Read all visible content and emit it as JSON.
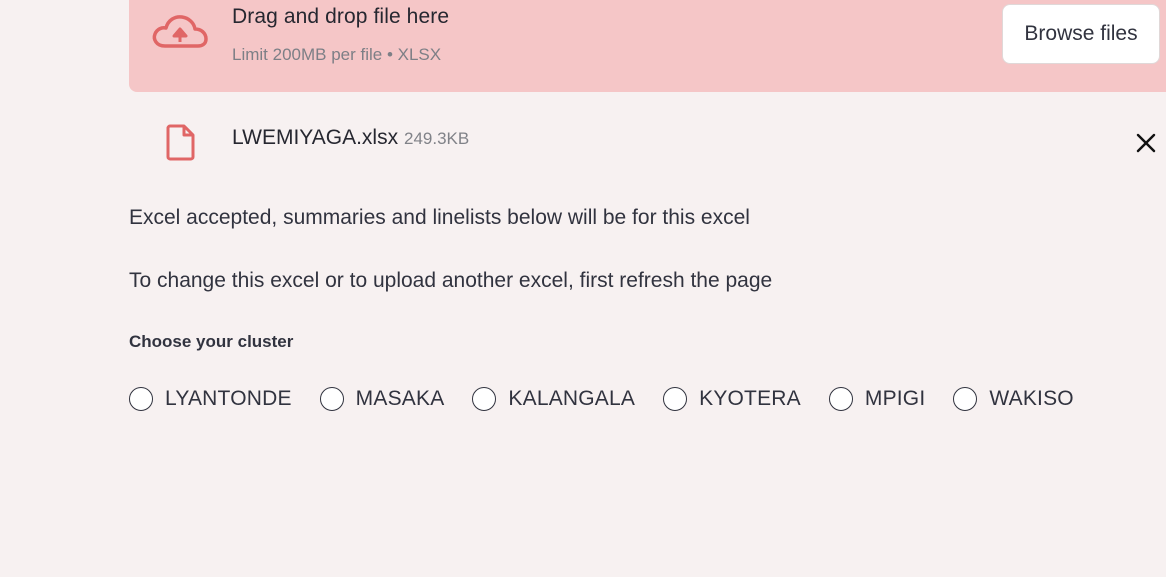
{
  "uploader": {
    "title": "Drag and drop file here",
    "limit_text": "Limit 200MB per file • XLSX",
    "browse_label": "Browse files",
    "icon": "cloud-upload-icon",
    "accent_color": "#e06666",
    "background_color": "#f5c6c7"
  },
  "uploaded_file": {
    "name": "LWEMIYAGA.xlsx",
    "size": "249.3KB",
    "icon": "file-icon",
    "remove_icon": "close-icon"
  },
  "messages": {
    "accepted": "Excel accepted, summaries and linelists below will be for this excel",
    "refresh": "To change this excel or to upload another excel, first refresh the page"
  },
  "cluster_radio": {
    "label": "Choose your cluster",
    "options": [
      "LYANTONDE",
      "MASAKA",
      "KALANGALA",
      "KYOTERA",
      "MPIGI",
      "WAKISO"
    ],
    "selected": null
  }
}
